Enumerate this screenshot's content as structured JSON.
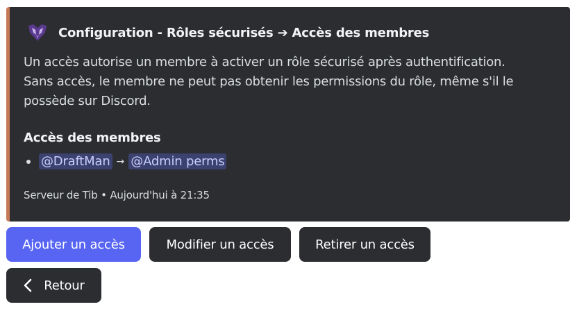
{
  "embed": {
    "accent_color": "#c77a57",
    "author": {
      "icon": "shield-logo-icon",
      "name": "Configuration - Rôles sécurisés ➔ Accès des membres"
    },
    "description_line1": "Un accès autorise un membre à activer un rôle sécurisé après authentification.",
    "description_line2": "Sans accès, le membre ne peut pas obtenir les permissions du rôle, même s'il le",
    "description_line3": "possède sur Discord.",
    "field": {
      "name": "Accès des membres",
      "items": [
        {
          "member": "@DraftMan",
          "arrow": "→",
          "role": "@Admin perms"
        }
      ]
    },
    "footer": "Serveur de Tib • Aujourd'hui à 21:35"
  },
  "buttons": {
    "add": "Ajouter un accès",
    "edit": "Modifier un accès",
    "remove": "Retirer un accès",
    "back": "Retour",
    "back_icon": "chevron-left-icon"
  },
  "colors": {
    "primary_button": "#5865f2",
    "secondary_button": "#2b2d31",
    "mention_bg": "#3c4270"
  }
}
